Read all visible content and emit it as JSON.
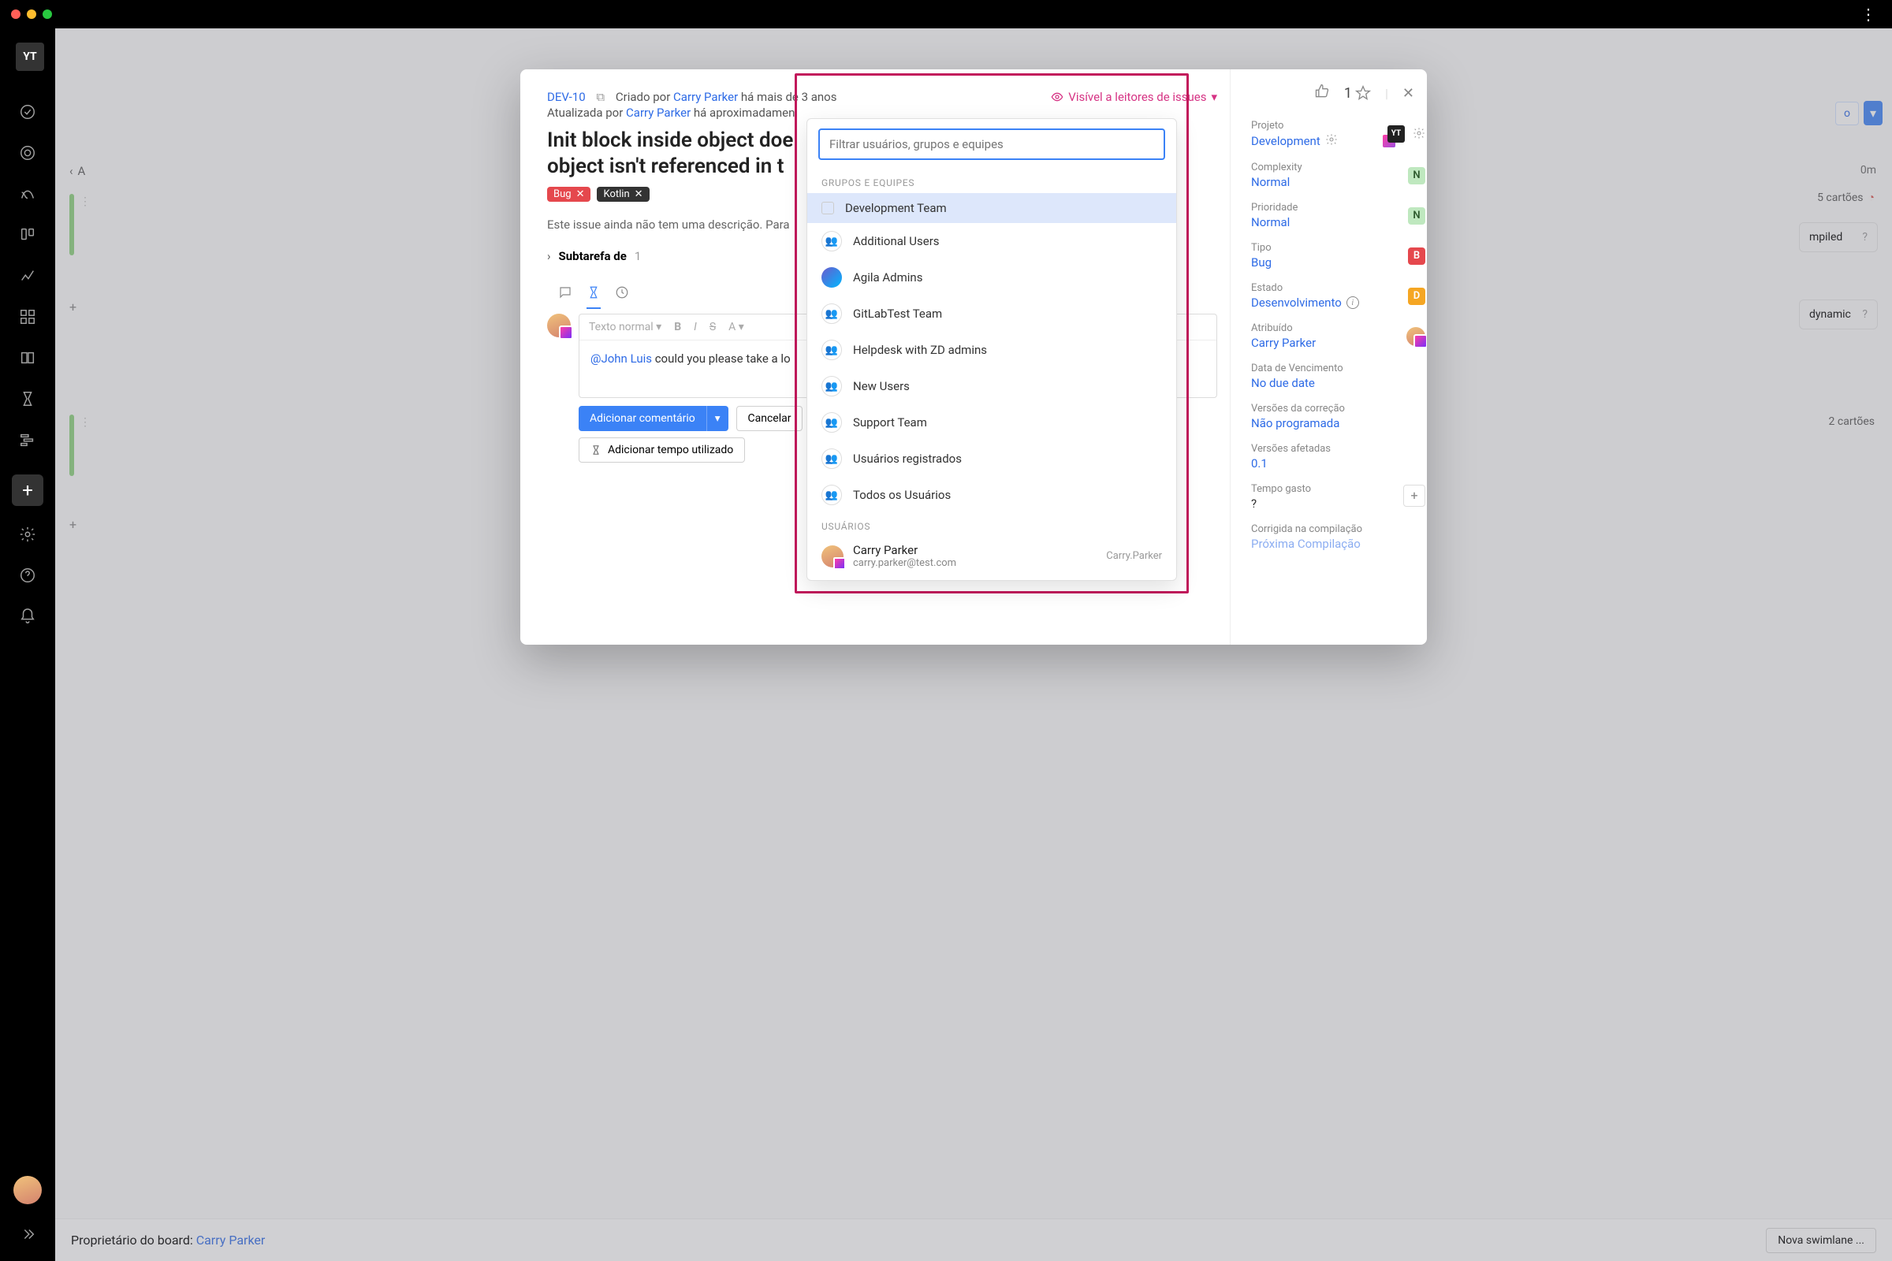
{
  "sidebar": {
    "logo": "YT"
  },
  "board": {
    "back_label": "A",
    "time_top": "0m",
    "cards_label_top": "5 cartões",
    "cards_label_mid": "2 cartões",
    "card1_text": "mpiled",
    "card2_text": "dynamic",
    "card_q": "?",
    "footer_prefix": "Proprietário do board: ",
    "footer_owner": "Carry Parker",
    "swimlane_btn": "Nova swimlane ..."
  },
  "issue": {
    "id": "DEV-10",
    "created_prefix": "Criado por ",
    "author": "Carry Parker",
    "created_rel": " há mais de 3 anos",
    "updated_prefix": "Atualizada por ",
    "updater": "Carry Parker",
    "updated_rel": " há aproximadamen",
    "visibility": "Visível a leitores de issues",
    "title": "Init block inside object doe\nobject isn't referenced in t",
    "tag_bug": "Bug",
    "tag_kotlin": "Kotlin",
    "desc_hint": "Este issue ainda não tem uma descrição. Para",
    "subtask_label": "Subtarefa de",
    "subtask_count": "1",
    "toolbar": {
      "style": "Texto normal",
      "b": "B",
      "i": "I",
      "s": "S",
      "a": "A"
    },
    "comment": {
      "mention": "@John Luis",
      "text": " could you please take a lo"
    },
    "btn_add": "Adicionar comentário",
    "btn_cancel": "Cancelar",
    "btn_time": "Adicionar tempo utilizado",
    "star_count": "1"
  },
  "dropdown": {
    "placeholder": "Filtrar usuários, grupos e equipes",
    "section_groups": "GRUPOS E EQUIPES",
    "section_users": "USUÁRIOS",
    "items": [
      "Development Team",
      "Additional Users",
      "Agila Admins",
      "GitLabTest Team",
      "Helpdesk with ZD admins",
      "New Users",
      "Support Team",
      "Usuários registrados",
      "Todos os Usuários"
    ],
    "user": {
      "name": "Carry Parker",
      "email": "carry.parker@test.com",
      "login": "Carry.Parker"
    }
  },
  "props": {
    "project_label": "Projeto",
    "project": "Development",
    "complexity_label": "Complexity",
    "complexity": "Normal",
    "complexity_badge": "N",
    "complexity_color": "#bfe8bf",
    "priority_label": "Prioridade",
    "priority": "Normal",
    "priority_badge": "N",
    "priority_color": "#bfe8bf",
    "type_label": "Tipo",
    "type": "Bug",
    "type_badge": "B",
    "type_color": "#e5484d",
    "state_label": "Estado",
    "state": "Desenvolvimento",
    "state_badge": "D",
    "state_color": "#f5a623",
    "assignee_label": "Atribuído",
    "assignee": "Carry Parker",
    "due_label": "Data de Vencimento",
    "due": "No due date",
    "fixver_label": "Versões da correção",
    "fixver": "Não programada",
    "affver_label": "Versões afetadas",
    "affver": "0.1",
    "spent_label": "Tempo gasto",
    "spent": "?",
    "fixedin_label": "Corrigida na compilação",
    "fixedin": "Próxima Compilação"
  }
}
